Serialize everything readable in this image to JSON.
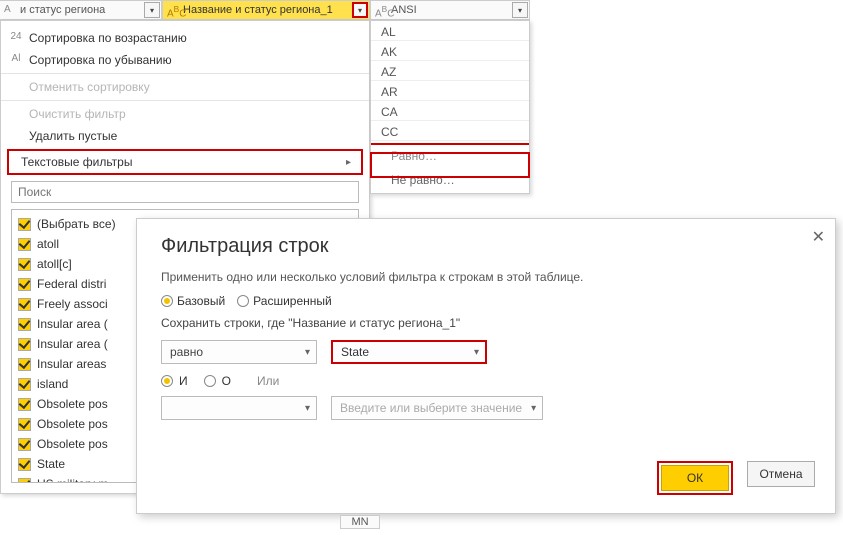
{
  "columns": {
    "c1": {
      "label": "и статус региона"
    },
    "c2": {
      "label": "Название и статус региона_1"
    },
    "c3": {
      "label": "ANSI"
    }
  },
  "menu": {
    "sort_asc_prefix": "24",
    "sort_asc": "Сортировка по возрастанию",
    "sort_desc_prefix": "Al",
    "sort_desc": "Сортировка по убыванию",
    "clear_sort": "Отменить сортировку",
    "clear_filter": "Очистить фильтр",
    "remove_empty": "Удалить пустые",
    "text_filters": "Текстовые фильтры",
    "search_placeholder": "Поиск"
  },
  "checklist": [
    "(Выбрать все)",
    "atoll",
    "atoll[c]",
    "Federal distri",
    "Freely associ",
    "Insular area (",
    "Insular area (",
    "Insular areas",
    "island",
    "Obsolete pos",
    "Obsolete pos",
    "Obsolete pos",
    "State",
    "US military m"
  ],
  "ansi_list": [
    "AL",
    "AK",
    "AZ",
    "AR",
    "CA",
    "CC"
  ],
  "text_filter_sub": {
    "equals": "Равно…",
    "not_equals": "Не равно…"
  },
  "dialog": {
    "title": "Фильтрация строк",
    "desc": "Применить одно или несколько условий фильтра к строкам в этой таблице.",
    "basic": "Базовый",
    "advanced": "Расширенный",
    "keep_prefix": "Сохранить строки, где \"",
    "keep_column": "Название и статус региона_1",
    "keep_suffix": "\"",
    "op_equals": "равно",
    "value_state": "State",
    "value_placeholder": "Введите или выберите значение",
    "and_label": "И",
    "or_label": "О",
    "or_text": "Или",
    "ok": "ОК",
    "cancel": "Отмена"
  },
  "preview_cell": "MN"
}
